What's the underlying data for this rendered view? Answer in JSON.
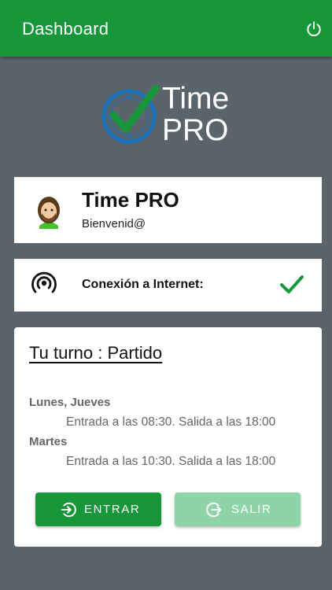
{
  "appbar": {
    "title": "Dashboard",
    "action_icon": "power-icon"
  },
  "logo": {
    "line1": "Time",
    "line2": "PRO",
    "icon": "clock-check-icon"
  },
  "profile": {
    "name": "Time PRO",
    "greeting": "Bienvenid@",
    "avatar_icon": "user-avatar-icon"
  },
  "connection": {
    "label": "Conexión a Internet:",
    "status_icon": "check-icon",
    "icon": "wifi-signal-icon"
  },
  "shift": {
    "title": "Tu turno : Partido",
    "schedule": [
      {
        "days": "Lunes, Jueves",
        "hours": "Entrada a las 08:30. Salida a las 18:00"
      },
      {
        "days": "Martes",
        "hours": "Entrada a las 10:30. Salida a las 18:00"
      }
    ]
  },
  "actions": {
    "enter_label": "ENTRAR",
    "exit_label": "SALIR"
  },
  "colors": {
    "primary": "#17963a",
    "primary_disabled": "#8fd4a6",
    "background": "#59656a",
    "logo_blue": "#1e73be"
  }
}
